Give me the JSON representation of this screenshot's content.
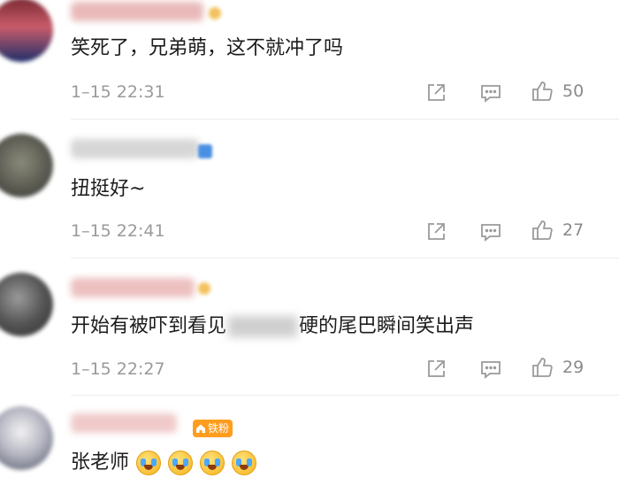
{
  "comments": [
    {
      "text": "笑死了，兄弟萌，这不就冲了吗",
      "time": "1–15 22:31",
      "likes": "50",
      "avatar_colors": [
        "#7a2a33",
        "#c95b6a",
        "#1e2f6a"
      ]
    },
    {
      "text": "扭挺好~",
      "time": "1–15 22:41",
      "likes": "27",
      "avatar_colors": [
        "#666",
        "#8a8a8a",
        "#555"
      ]
    },
    {
      "text_before": "开始有被吓到看见",
      "text_after": "硬的尾巴瞬间笑出声",
      "time": "1–15 22:27",
      "likes": "29",
      "avatar_colors": [
        "#444",
        "#777",
        "#333"
      ]
    },
    {
      "text": "张老师",
      "tag": "铁粉",
      "emoji_count": 4,
      "avatar_colors": [
        "#e9e9e9",
        "#556",
        "#999"
      ]
    }
  ],
  "colors": {
    "accent_orange": "#ff9d1f",
    "muted_text": "#9a9a9a",
    "badge_blue": "#4a90e2"
  },
  "icons": [
    "share-icon",
    "comment-icon",
    "like-icon",
    "crying-emoji-icon"
  ]
}
